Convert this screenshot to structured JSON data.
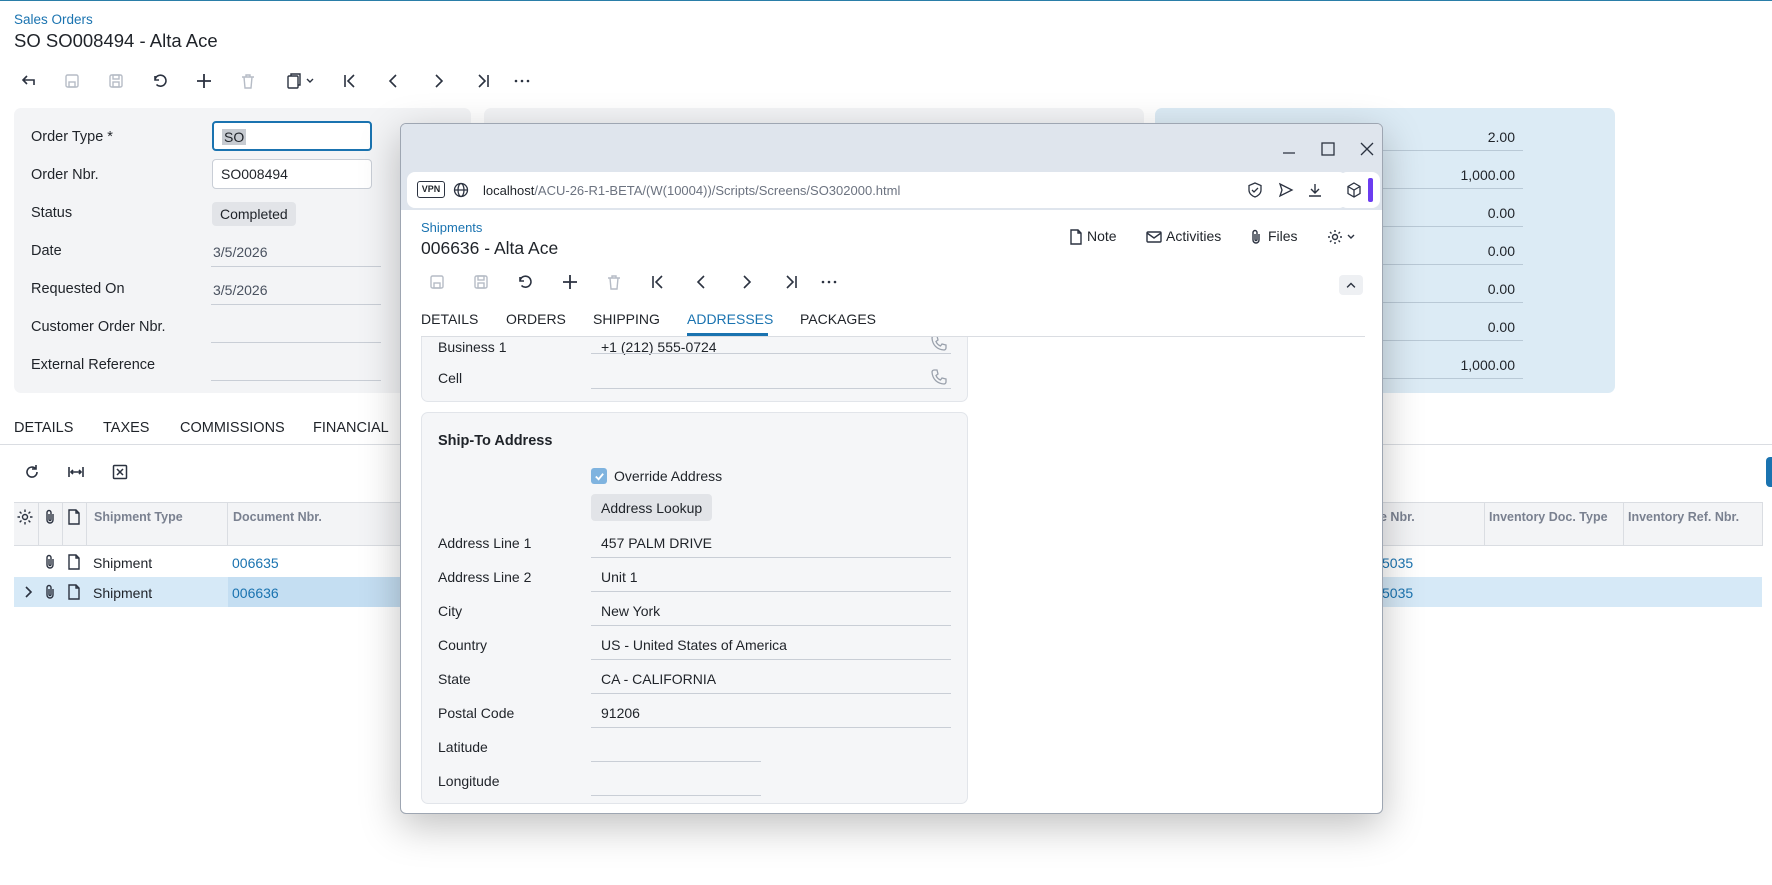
{
  "page": {
    "breadcrumb": "Sales Orders",
    "title": "SO SO008494 - Alta Ace"
  },
  "form": {
    "order_type_label": "Order Type *",
    "order_type_value": "SO",
    "order_nbr_label": "Order Nbr.",
    "order_nbr_value": "SO008494",
    "status_label": "Status",
    "status_value": "Completed",
    "date_label": "Date",
    "date_value": "3/5/2026",
    "requested_on_label": "Requested On",
    "requested_on_value": "3/5/2026",
    "customer_order_label": "Customer Order Nbr.",
    "customer_order_value": "",
    "external_ref_label": "External Reference",
    "external_ref_value": ""
  },
  "totals": [
    "2.00",
    "1,000.00",
    "0.00",
    "0.00",
    "0.00",
    "0.00",
    "1,000.00"
  ],
  "tabs": [
    "DETAILS",
    "TAXES",
    "COMMISSIONS",
    "FINANCIAL"
  ],
  "grid": {
    "headers": [
      "Shipment Type",
      "Document Nbr.",
      "e Nbr.",
      "Inventory Doc. Type",
      "Inventory Ref. Nbr."
    ],
    "rows": [
      {
        "type": "Shipment",
        "doc": "006635",
        "nbr": "5035"
      },
      {
        "type": "Shipment",
        "doc": "006636",
        "nbr": "5035"
      }
    ]
  },
  "browser": {
    "vpn": "VPN",
    "url_host": "localhost",
    "url_path": "/ACU-26-R1-BETA/(W(10004))/Scripts/Screens/SO302000.html"
  },
  "modal": {
    "breadcrumb": "Shipments",
    "title": "006636 - Alta Ace",
    "note": "Note",
    "activities": "Activities",
    "files": "Files",
    "tabs": [
      "DETAILS",
      "ORDERS",
      "SHIPPING",
      "ADDRESSES",
      "PACKAGES"
    ],
    "active_tab": "ADDRESSES",
    "business1_label": "Business 1",
    "business1_value": "+1 (212) 555-0724",
    "cell_label": "Cell",
    "cell_value": "",
    "ship_to": {
      "heading": "Ship-To Address",
      "override_label": "Override Address",
      "override_checked": true,
      "lookup_button": "Address Lookup",
      "address1_label": "Address Line 1",
      "address1_value": "457 PALM DRIVE",
      "address2_label": "Address Line 2",
      "address2_value": "Unit 1",
      "city_label": "City",
      "city_value": "New York",
      "country_label": "Country",
      "country_value": "US - United States of America",
      "state_label": "State",
      "state_value": "CA - CALIFORNIA",
      "postal_label": "Postal Code",
      "postal_value": "91206",
      "latitude_label": "Latitude",
      "latitude_value": "",
      "longitude_label": "Longitude",
      "longitude_value": ""
    }
  },
  "colors": {
    "accent": "#1a73b0",
    "panel": "#f3f4f6",
    "summary_panel": "#dcebf5",
    "selected_row": "#d6e9f7"
  }
}
